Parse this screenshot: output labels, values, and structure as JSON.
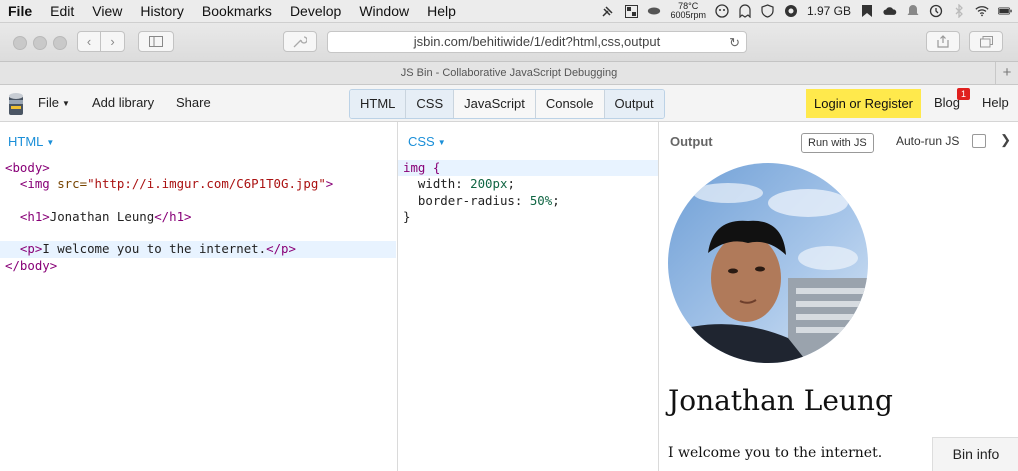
{
  "menubar": {
    "items": [
      "File",
      "Edit",
      "View",
      "History",
      "Bookmarks",
      "Develop",
      "Window",
      "Help"
    ],
    "temp": "78°C",
    "rpm": "6005rpm",
    "memory": "1.97 GB"
  },
  "toolbar": {
    "url": "jsbin.com/behitiwide/1/edit?html,css,output"
  },
  "titlebar": {
    "title": "JS Bin - Collaborative JavaScript Debugging",
    "new_tab": "+"
  },
  "jsbin": {
    "file_menu": "File",
    "add_library": "Add library",
    "share": "Share",
    "panels": [
      {
        "label": "HTML",
        "active": true
      },
      {
        "label": "CSS",
        "active": true
      },
      {
        "label": "JavaScript",
        "active": false
      },
      {
        "label": "Console",
        "active": false
      },
      {
        "label": "Output",
        "active": true
      }
    ],
    "login": "Login or Register",
    "blog": "Blog",
    "blog_badge": "1",
    "help": "Help"
  },
  "html_pane": {
    "label": "HTML"
  },
  "css_pane": {
    "label": "CSS"
  },
  "html_code": {
    "l1": "<body>",
    "l2_a": "  <img ",
    "l2_attr": "src=",
    "l2_str": "\"http://i.imgur.com/C6P1T0G.jpg\"",
    "l2_b": ">",
    "l4_a": "  <h1>",
    "l4_t": "Jonathan Leung",
    "l4_b": "</h1>",
    "l6_a": "  <p>",
    "l6_t": "I welcome you to the internet.",
    "l6_b": "</p>",
    "l7": "</body>"
  },
  "css_code": {
    "l1": "img {",
    "l2_p": "  width: ",
    "l2_v": "200px",
    "l2_e": ";",
    "l3_p": "  border-radius: ",
    "l3_v": "50%",
    "l3_e": ";",
    "l4": "}"
  },
  "output": {
    "label": "Output",
    "run_js": "Run with JS",
    "auto_run": "Auto-run JS",
    "collapse": "❯",
    "heading": "Jonathan Leung",
    "paragraph": "I welcome you to the internet.",
    "bin_info": "Bin info"
  },
  "colors": {
    "accent": "#1b8fd8",
    "login_bg": "#ffe94c",
    "badge": "#e0201e"
  }
}
